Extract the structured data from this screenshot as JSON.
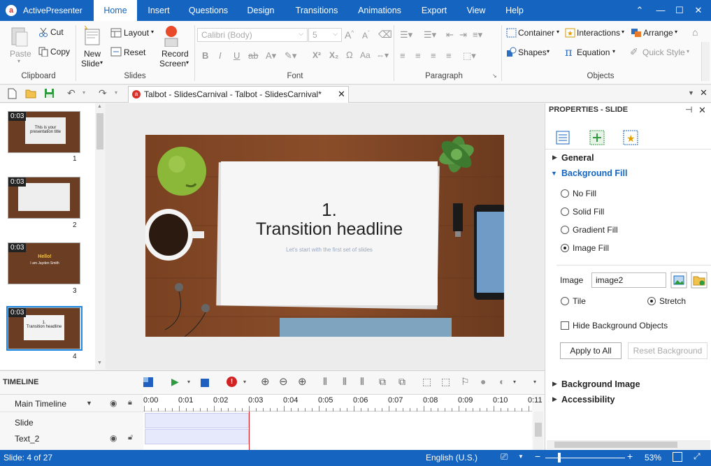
{
  "app": {
    "name": "ActivePresenter"
  },
  "tabs": [
    "Home",
    "Insert",
    "Questions",
    "Design",
    "Transitions",
    "Animations",
    "Export",
    "View",
    "Help"
  ],
  "active_tab": "Home",
  "ribbon": {
    "clipboard": {
      "paste": "Paste",
      "cut": "Cut",
      "copy": "Copy",
      "label": "Clipboard"
    },
    "slides": {
      "new_slide_1": "New",
      "new_slide_2": "Slide",
      "layout": "Layout",
      "reset": "Reset",
      "record_1": "Record",
      "record_2": "Screen",
      "label": "Slides"
    },
    "font": {
      "family": "Calibri (Body)",
      "size": "5",
      "label": "Font"
    },
    "paragraph": {
      "label": "Paragraph"
    },
    "objects": {
      "container": "Container",
      "interactions": "Interactions",
      "arrange": "Arrange",
      "shapes": "Shapes",
      "equation": "Equation",
      "quick_style": "Quick Style",
      "label": "Objects"
    }
  },
  "document_tab": {
    "title": "Talbot - SlidesCarnival - Talbot - SlidesCarnival*"
  },
  "slides": [
    {
      "num": "1",
      "time": "0:03",
      "text1": "This is your",
      "text2": "presentation title"
    },
    {
      "num": "2",
      "time": "0:03"
    },
    {
      "num": "3",
      "time": "0:03",
      "text1": "Hello!",
      "text2": "I am Jayden Smith"
    },
    {
      "num": "4",
      "time": "0:03",
      "text1": "1.",
      "text2": "Transition headline"
    }
  ],
  "current_slide": {
    "number": "1.",
    "headline": "Transition headline",
    "subtitle": "Let's start with the first set of slides"
  },
  "properties": {
    "title": "PROPERTIES - SLIDE",
    "general": "General",
    "background_fill": "Background Fill",
    "no_fill": "No Fill",
    "solid_fill": "Solid Fill",
    "gradient_fill": "Gradient Fill",
    "image_fill": "Image Fill",
    "image_label": "Image",
    "image_value": "image2",
    "tile": "Tile",
    "stretch": "Stretch",
    "hide_bg_objects": "Hide Background Objects",
    "apply_all": "Apply to All",
    "reset_bg": "Reset Background",
    "background_image": "Background Image",
    "accessibility": "Accessibility"
  },
  "timeline": {
    "title": "TIMELINE",
    "main": "Main Timeline",
    "ticks": [
      "0:00",
      "0:01",
      "0:02",
      "0:03",
      "0:04",
      "0:05",
      "0:06",
      "0:07",
      "0:08",
      "0:09",
      "0:10",
      "0:11"
    ],
    "tracks": [
      "Slide",
      "Text_2"
    ]
  },
  "status": {
    "slide": "Slide: 4 of 27",
    "language": "English (U.S.)",
    "zoom": "53%"
  },
  "colors": {
    "accent": "#1565c0",
    "playhead": "#e02020"
  }
}
